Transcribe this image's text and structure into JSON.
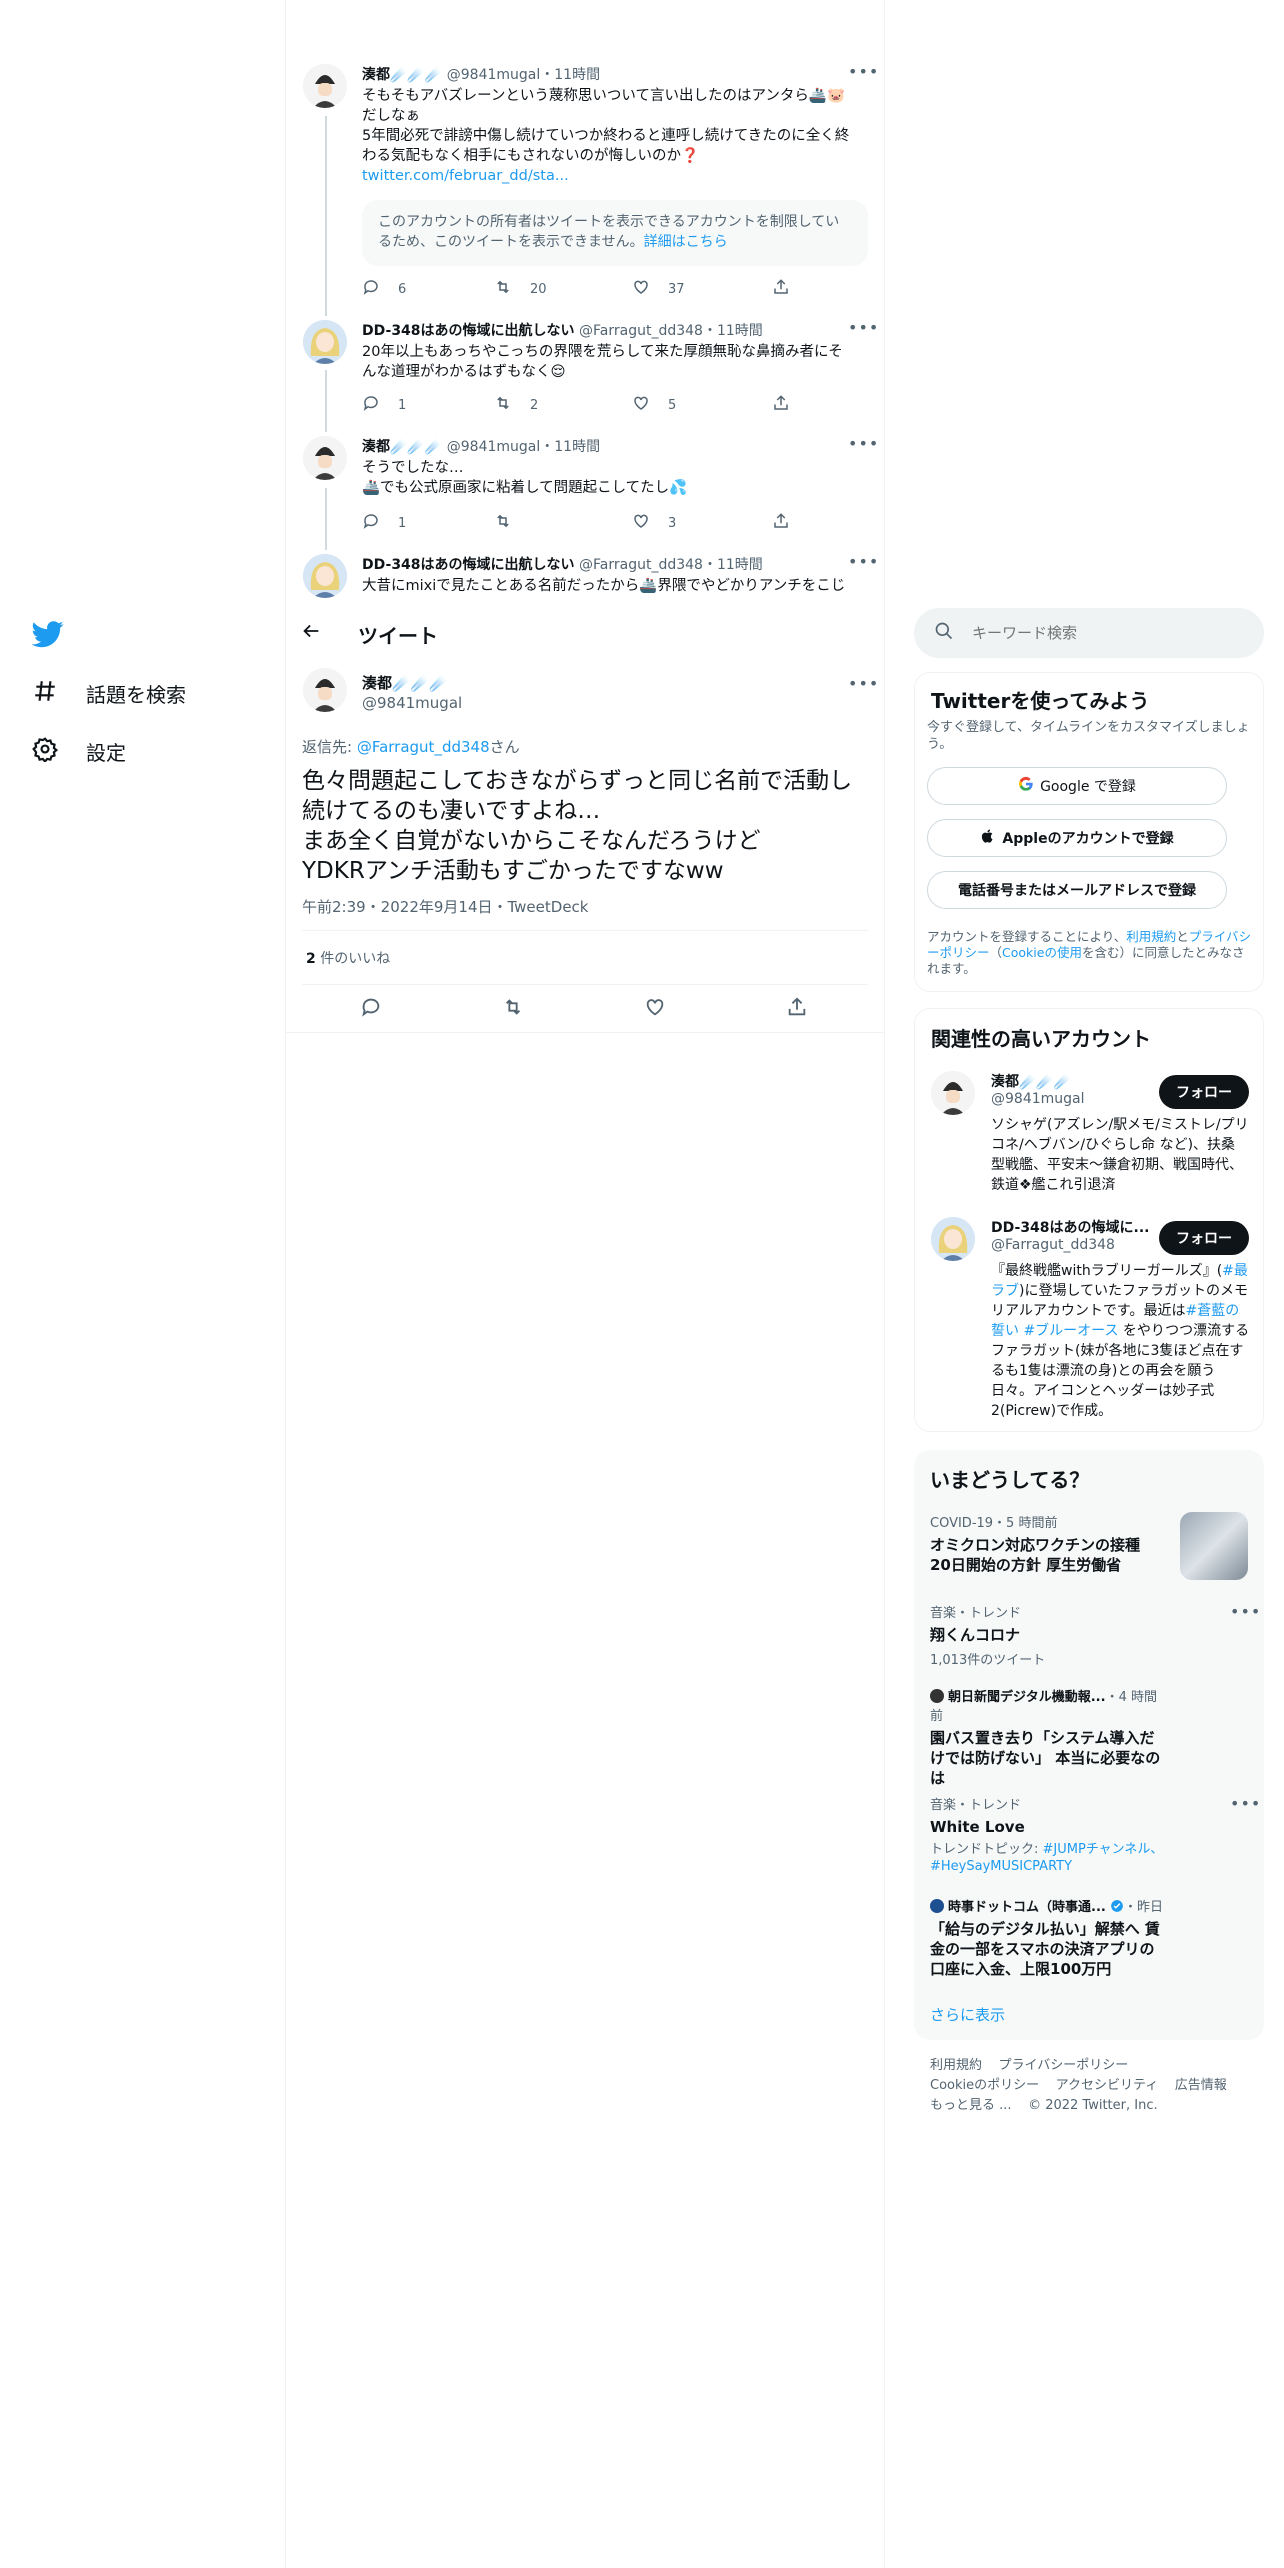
{
  "nav": {
    "items": [
      {
        "label": "話題を検索",
        "icon": "hashtag-icon"
      },
      {
        "label": "設定",
        "icon": "gear-icon"
      }
    ]
  },
  "thread": [
    {
      "name": "湊都☄️☄️☄️",
      "handle": "@9841mugal",
      "time": "11時間",
      "text_lines": [
        "そもそもアバズレーンという蔑称思いついて言い出したのはアンタら🚢🐷",
        "だしなぁ",
        "5年間必死で誹謗中傷し続けていつか終わると連呼し続けてきたのに全く終",
        "わる気配もなく相手にもされないのが悔しいのか❓"
      ],
      "link": "twitter.com/februar_dd/sta...",
      "notice": "このアカウントの所有者はツイートを表示できるアカウントを制限しているため、このツイートを表示できません。",
      "notice_link": "詳細はこちら",
      "replies": "6",
      "retweets": "20",
      "likes": "37"
    },
    {
      "name": "DD-348はあの悔域に出航しない",
      "handle": "@Farragut_dd348",
      "time": "11時間",
      "text_lines": [
        "20年以上もあっちやこっちの界隈を荒らして来た厚顔無恥な鼻摘み者にそ",
        "んな道理がわかるはずもなく😌"
      ],
      "replies": "1",
      "retweets": "2",
      "likes": "5"
    },
    {
      "name": "湊都☄️☄️☄️",
      "handle": "@9841mugal",
      "time": "11時間",
      "text_lines": [
        "そうでしたな…",
        "🚢でも公式原画家に粘着して問題起こしてたし💦"
      ],
      "replies": "1",
      "retweets": "",
      "likes": "3"
    },
    {
      "name": "DD-348はあの悔域に出航しない",
      "handle": "@Farragut_dd348",
      "time": "11時間",
      "text_lines": [
        "大昔にmixiで見たことある名前だったから🚢界隈でやどかりアンチをこじ"
      ]
    }
  ],
  "header": {
    "title": "ツイート"
  },
  "main_tweet": {
    "name": "湊都☄️☄️☄️",
    "handle": "@9841mugal",
    "reply_prefix": "返信先: ",
    "reply_to": "@Farragut_dd348",
    "reply_suffix": "さん",
    "text_lines": [
      "色々問題起こしておきながらずっと同じ名前で活動し",
      "続けてるのも凄いですよね…",
      "まあ全く自覚がないからこそなんだろうけど",
      "YDKRアンチ活動もすごかったですなww"
    ],
    "meta": "午前2:39・2022年9月14日・TweetDeck",
    "likes_count": "2",
    "likes_label": " 件のいいね"
  },
  "search": {
    "placeholder": "キーワード検索"
  },
  "signup": {
    "title": "Twitterを使ってみよう",
    "subtitle": "今すぐ登録して、タイムラインをカスタマイズしましょう。",
    "google": "Google で登録",
    "apple": "Appleのアカウントで登録",
    "phone": "電話番号またはメールアドレスで登録",
    "terms_1": "アカウントを登録することにより、",
    "terms_link1": "利用規約",
    "terms_2": "と",
    "terms_link2": "プライバシーポリシー",
    "terms_3": "（",
    "terms_link3": "Cookieの使用",
    "terms_4": "を含む）に同意したとみなされます。"
  },
  "related": {
    "title": "関連性の高いアカウント",
    "follow_label": "フォロー",
    "accounts": [
      {
        "name": "湊都☄️☄️☄️",
        "handle": "@9841mugal",
        "bio": "ソシャゲ(アズレン/駅メモ/ミストレ/プリコネ/ヘブバン/ひぐらし命 など)、扶桑型戦艦、平安末～鎌倉初期、戦国時代、鉄道❖艦これ引退済"
      },
      {
        "name": "DD-348はあの悔域に...",
        "handle": "@Farragut_dd348",
        "bio_1": "『最終戦艦withラブリーガールズ』(",
        "bio_link1": "#最ラブ",
        "bio_2": ")に登場していたファラガットのメモリアルアカウントです。最近は",
        "bio_link2": "#蒼藍の誓い",
        "bio_3": " ",
        "bio_link3": "#ブルーオース",
        "bio_4": " をやりつつ漂流するファラガット(妹が各地に3隻ほど点在するも1隻は漂流の身)との再会を願う日々。アイコンとヘッダーは妙子式2(Picrew)で作成。"
      }
    ]
  },
  "trends": {
    "title": "いまどうしてる？",
    "items": [
      {
        "meta": "COVID-19・5 時間前",
        "title": "オミクロン対応ワクチンの接種 20日開始の方針 厚生労働省"
      },
      {
        "meta": "音楽・トレンド",
        "title": "翔くんコロナ",
        "count": "1,013件のツイート"
      },
      {
        "source": "朝日新聞デジタル機動報...",
        "meta": "・4 時間前",
        "title": "園バス置き去り「システム導入だけでは防げない」 本当に必要なのは"
      },
      {
        "meta": "音楽・トレンド",
        "title": "White Love",
        "topic_label": "トレンドトピック: ",
        "topic": "#JUMPチャンネル、#HeySayMUSICPARTY"
      },
      {
        "source": "時事ドットコム（時事通...",
        "meta": "・昨日",
        "title": "「給与のデジタル払い」解禁へ 賃金の一部をスマホの決済アプリの口座に入金、上限100万円"
      }
    ],
    "show_more": "さらに表示"
  },
  "footer": {
    "links": [
      "利用規約",
      "プライバシーポリシー",
      "Cookieのポリシー",
      "アクセシビリティ",
      "広告情報",
      "もっと見る ..."
    ],
    "copyright": "© 2022 Twitter, Inc."
  },
  "colors": {
    "accent": "#1d9bf0",
    "text": "#0f1419",
    "muted": "#536471",
    "border": "#eff3f4",
    "panel": "#f7f9f9"
  }
}
